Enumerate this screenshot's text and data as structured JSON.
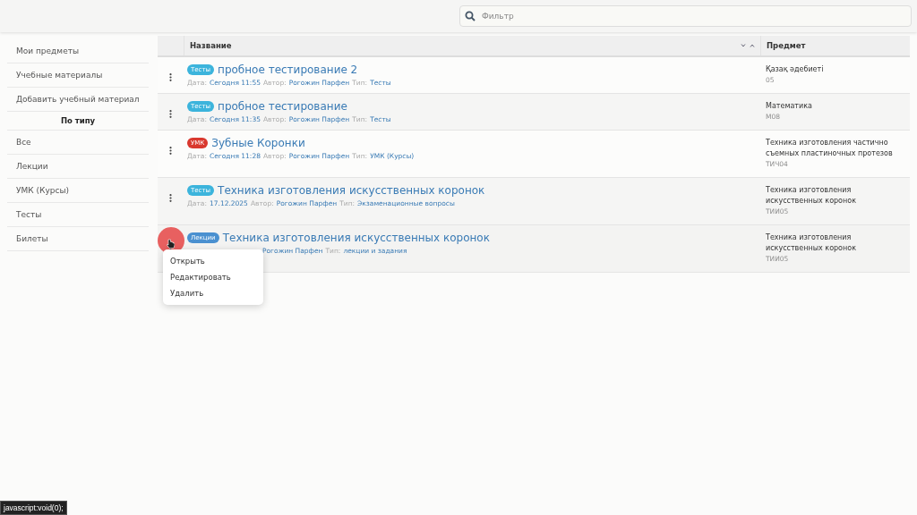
{
  "search": {
    "placeholder": "Фильтр"
  },
  "sidebar": {
    "items": [
      {
        "label": "Мои предметы",
        "kind": "link"
      },
      {
        "label": "Учебные материалы",
        "kind": "link"
      },
      {
        "label": "Добавить учебный материал",
        "kind": "link"
      },
      {
        "label": "По типу",
        "kind": "heading"
      },
      {
        "label": "Все",
        "kind": "link"
      },
      {
        "label": "Лекции",
        "kind": "link"
      },
      {
        "label": "УМК (Курсы)",
        "kind": "link"
      },
      {
        "label": "Тесты",
        "kind": "link"
      },
      {
        "label": "Билеты",
        "kind": "link"
      }
    ]
  },
  "table": {
    "columns": [
      "Название",
      "Предмет"
    ],
    "rows": [
      {
        "badge": "Тесты",
        "color": "#3cb4dc",
        "title": "пробное тестирование 2",
        "date_label": "Дата:",
        "date": "Сегодня 11:55",
        "author_label": "Автор:",
        "author": "Рогожин Парфен",
        "type_label": "Тип:",
        "type": "Тесты",
        "subject": "Қазақ әдебиеті",
        "code": "05",
        "hovered": false
      },
      {
        "badge": "Тесты",
        "color": "#3cb4dc",
        "title": "пробное тестирование",
        "date_label": "Дата:",
        "date": "Сегодня 11:35",
        "author_label": "Автор:",
        "author": "Рогожин Парфен",
        "type_label": "Тип:",
        "type": "Тесты",
        "subject": "Математика",
        "code": "М08",
        "hovered": false
      },
      {
        "badge": "УМК",
        "color": "#d9382e",
        "title": "Зубные Коронки",
        "date_label": "Дата:",
        "date": "Сегодня 11:28",
        "author_label": "Автор:",
        "author": "Рогожин Парфен",
        "type_label": "Тип:",
        "type": "УМК (Курсы)",
        "subject": "Техника изготовления частично съемных пластиночных протезов",
        "code": "ТИЧ04",
        "hovered": false
      },
      {
        "badge": "Тесты",
        "color": "#3cb4dc",
        "title": "Техника изготовления искусственных коронок",
        "date_label": "Дата:",
        "date": "17.12.2025",
        "author_label": "Автор:",
        "author": "Рогожин Парфен",
        "type_label": "Тип:",
        "type": "Экзаменационные вопросы",
        "subject": "Техника изготовления искусственных коронок",
        "code": "ТИИ05",
        "hovered": false
      },
      {
        "badge": "Лекции",
        "color": "#4a90d0",
        "title": "Техника изготовления искусственных коронок",
        "author": "Рогожин Парфен",
        "type_label": "Тип:",
        "type": "лекции и задания",
        "subject": "Техника изготовления искусственных коронок",
        "code": "ТИИ05",
        "hovered": true
      }
    ]
  },
  "context_menu": {
    "items": [
      "Открыть",
      "Редактировать",
      "Удалить"
    ]
  },
  "status_bar": {
    "url": "javascript:void(0);"
  }
}
